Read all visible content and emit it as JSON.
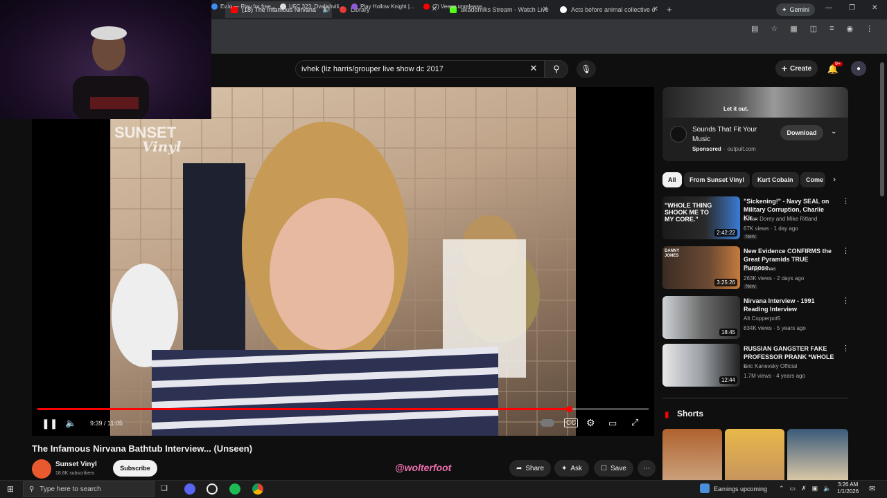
{
  "browser": {
    "tabs": [
      {
        "label": "(18) The Infamous Nirvana",
        "active": true
      },
      {
        "label": "Library"
      },
      {
        "label": "akademiks Stream - Watch Live"
      },
      {
        "label": "Acts before animal collective o"
      }
    ],
    "new_tab": "+",
    "gemini": "Gemini",
    "bookmarks": [
      "Ev.io — Play for free...",
      "UFC 323: Dvalishvili...",
      "Play Hollow Knight |...",
      "(2) Veeze unrelease..."
    ]
  },
  "youtube": {
    "search_value": "ivhek (liz harris/grouper live show dc 2017",
    "create_label": "Create",
    "notif_count": "9+",
    "player": {
      "time": "9:39 / 11:05",
      "progress": 0.87,
      "watermark_line1": "SUNSET",
      "watermark_line2": "Vinyl"
    },
    "video_title": "The Infamous Nirvana Bathtub Interview... (Unseen)",
    "channel": {
      "name": "Sunset Vinyl",
      "subs": "18.6K subscribers",
      "subscribe": "Subscribe"
    },
    "actions": {
      "share": "Share",
      "ask": "Ask",
      "save": "Save",
      "more": "⋯"
    },
    "overlay_text": "@wolterfoot"
  },
  "sidebar": {
    "ad": {
      "title": "Sounds That Fit Your Music",
      "sponsored": "Sponsored",
      "domain": "outpult.com",
      "download": "Download",
      "banner": "Let it out."
    },
    "chips": [
      "All",
      "From Sunset Vinyl",
      "Kurt Cobain",
      "Come"
    ],
    "recs": [
      {
        "title": "\"Sickening!\" - Navy SEAL on Military Corruption, Charlie Kir...",
        "channel": "Julian Dorey and Mike Ritland",
        "meta": "67K views · 1 day ago",
        "badge": "New",
        "duration": "2:42:22",
        "thumb_text": "\"WHOLE THING SHOOK ME TO MY CORE.\""
      },
      {
        "title": "New Evidence CONFIRMS the Great Pyramids TRUE Purpose...",
        "channel": "Danny Jones",
        "meta": "263K views · 2 days ago",
        "badge": "New",
        "duration": "3:25:26",
        "thumb_text": "DANNY JONES"
      },
      {
        "title": "Nirvana Interview - 1991 Reading Interview",
        "channel": "Alt Copperpot5",
        "meta": "834K views · 5 years ago",
        "badge": "",
        "duration": "18:45",
        "thumb_text": ""
      },
      {
        "title": "RUSSIAN GANGSTER FAKE PROFESSOR PRANK *WHOLE ...",
        "channel": "Eric Kanevsky Official",
        "meta": "1.7M views · 4 years ago",
        "badge": "",
        "duration": "12:44",
        "thumb_text": ""
      }
    ],
    "shorts_label": "Shorts"
  },
  "taskbar": {
    "search_placeholder": "Type here to search",
    "weather": "Earnings upcoming",
    "time": "3:26 AM",
    "date": "1/1/2026"
  },
  "colors": {
    "yt_red": "#ff0000",
    "bg": "#0f0f0f",
    "chip": "#272727"
  }
}
